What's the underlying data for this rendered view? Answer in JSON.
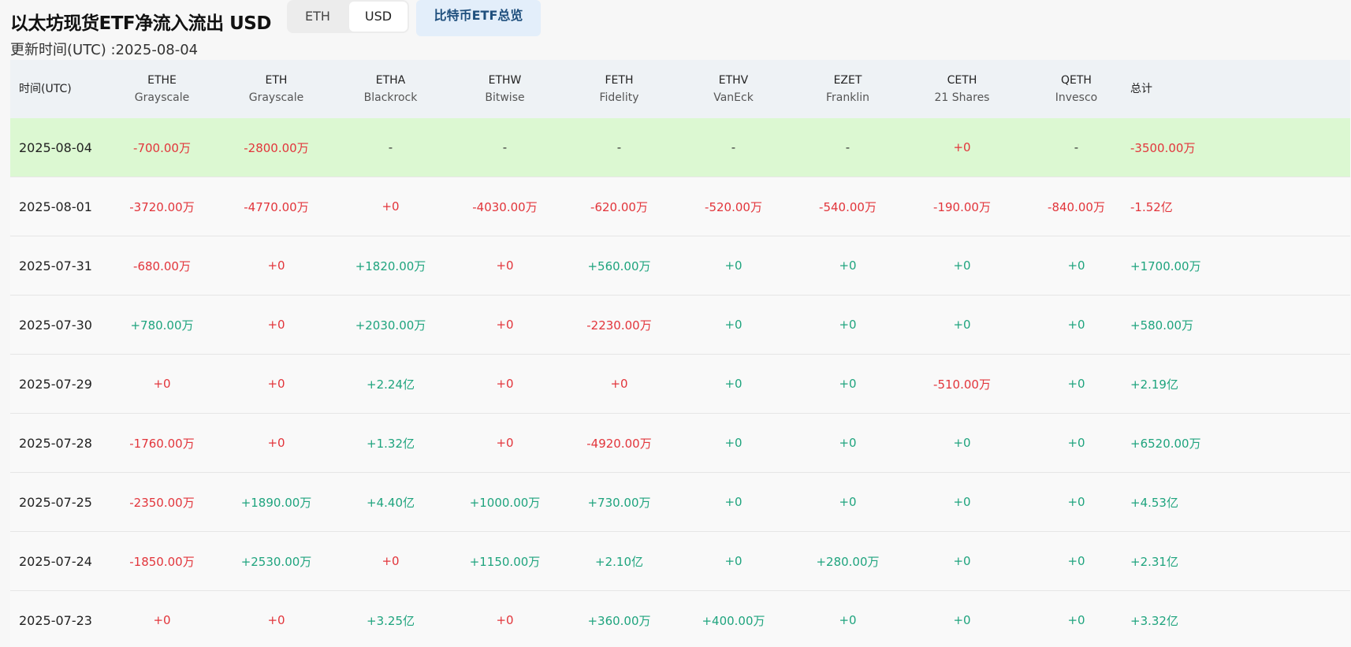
{
  "header": {
    "title": "以太坊现货ETF净流入流出 USD",
    "toggle": {
      "eth_label": "ETH",
      "usd_label": "USD",
      "selected": "USD"
    },
    "btc_overview_label": "比特币ETF总览",
    "updated": "更新时间(UTC) :2025-08-04"
  },
  "colors": {
    "positive": "#1fa47e",
    "negative": "#e2353b",
    "highlight_row": "#dcf8d2",
    "header_bg": "#eef2f5",
    "button_accent": "#1f4f7d"
  },
  "table": {
    "columns": [
      {
        "ticker": "时间(UTC)",
        "issuer": ""
      },
      {
        "ticker": "ETHE",
        "issuer": "Grayscale"
      },
      {
        "ticker": "ETH",
        "issuer": "Grayscale"
      },
      {
        "ticker": "ETHA",
        "issuer": "Blackrock"
      },
      {
        "ticker": "ETHW",
        "issuer": "Bitwise"
      },
      {
        "ticker": "FETH",
        "issuer": "Fidelity"
      },
      {
        "ticker": "ETHV",
        "issuer": "VanEck"
      },
      {
        "ticker": "EZET",
        "issuer": "Franklin"
      },
      {
        "ticker": "CETH",
        "issuer": "21 Shares"
      },
      {
        "ticker": "QETH",
        "issuer": "Invesco"
      },
      {
        "ticker": "总计",
        "issuer": ""
      }
    ],
    "rows": [
      {
        "date": "2025-08-04",
        "highlight": true,
        "values": [
          "-700.00万",
          "-2800.00万",
          "-",
          "-",
          "-",
          "-",
          "-",
          "+0",
          "-",
          "-3500.00万"
        ]
      },
      {
        "date": "2025-08-01",
        "highlight": false,
        "values": [
          "-3720.00万",
          "-4770.00万",
          "+0",
          "-4030.00万",
          "-620.00万",
          "-520.00万",
          "-540.00万",
          "-190.00万",
          "-840.00万",
          "-1.52亿"
        ]
      },
      {
        "date": "2025-07-31",
        "highlight": false,
        "values": [
          "-680.00万",
          "+0",
          "+1820.00万",
          "+0",
          "+560.00万",
          "+0",
          "+0",
          "+0",
          "+0",
          "+1700.00万"
        ]
      },
      {
        "date": "2025-07-30",
        "highlight": false,
        "values": [
          "+780.00万",
          "+0",
          "+2030.00万",
          "+0",
          "-2230.00万",
          "+0",
          "+0",
          "+0",
          "+0",
          "+580.00万"
        ]
      },
      {
        "date": "2025-07-29",
        "highlight": false,
        "values": [
          "+0",
          "+0",
          "+2.24亿",
          "+0",
          "+0",
          "+0",
          "+0",
          "-510.00万",
          "+0",
          "+2.19亿"
        ]
      },
      {
        "date": "2025-07-28",
        "highlight": false,
        "values": [
          "-1760.00万",
          "+0",
          "+1.32亿",
          "+0",
          "-4920.00万",
          "+0",
          "+0",
          "+0",
          "+0",
          "+6520.00万"
        ]
      },
      {
        "date": "2025-07-25",
        "highlight": false,
        "values": [
          "-2350.00万",
          "+1890.00万",
          "+4.40亿",
          "+1000.00万",
          "+730.00万",
          "+0",
          "+0",
          "+0",
          "+0",
          "+4.53亿"
        ]
      },
      {
        "date": "2025-07-24",
        "highlight": false,
        "values": [
          "-1850.00万",
          "+2530.00万",
          "+0",
          "+1150.00万",
          "+2.10亿",
          "+0",
          "+280.00万",
          "+0",
          "+0",
          "+2.31亿"
        ]
      },
      {
        "date": "2025-07-23",
        "highlight": false,
        "values": [
          "+0",
          "+0",
          "+3.25亿",
          "+0",
          "+360.00万",
          "+400.00万",
          "+0",
          "+0",
          "+0",
          "+3.32亿"
        ]
      }
    ],
    "value_colors": {
      "ETHE": [
        "neg",
        "neg",
        "neg",
        "pos",
        "neg",
        "neg",
        "neg",
        "neg",
        "neg"
      ],
      "ETH": [
        "neg",
        "neg",
        "neg",
        "neg",
        "neg",
        "neg",
        "pos",
        "pos",
        "neg"
      ],
      "ETHA": [
        "nil",
        "neg",
        "pos",
        "pos",
        "pos",
        "pos",
        "pos",
        "neg",
        "pos"
      ],
      "ETHW": [
        "nil",
        "neg",
        "neg",
        "neg",
        "neg",
        "neg",
        "pos",
        "pos",
        "neg"
      ],
      "FETH": [
        "nil",
        "neg",
        "pos",
        "neg",
        "neg",
        "neg",
        "pos",
        "pos",
        "pos"
      ],
      "ETHV": [
        "nil",
        "neg",
        "pos",
        "pos",
        "pos",
        "pos",
        "pos",
        "pos",
        "pos"
      ],
      "EZET": [
        "nil",
        "neg",
        "pos",
        "pos",
        "pos",
        "pos",
        "pos",
        "pos",
        "pos"
      ],
      "CETH": [
        "neg",
        "neg",
        "pos",
        "pos",
        "neg",
        "pos",
        "pos",
        "pos",
        "pos"
      ],
      "QETH": [
        "nil",
        "neg",
        "pos",
        "pos",
        "pos",
        "pos",
        "pos",
        "pos",
        "pos"
      ],
      "TOTAL": [
        "neg",
        "neg",
        "pos",
        "pos",
        "pos",
        "pos",
        "pos",
        "pos",
        "pos"
      ]
    }
  }
}
